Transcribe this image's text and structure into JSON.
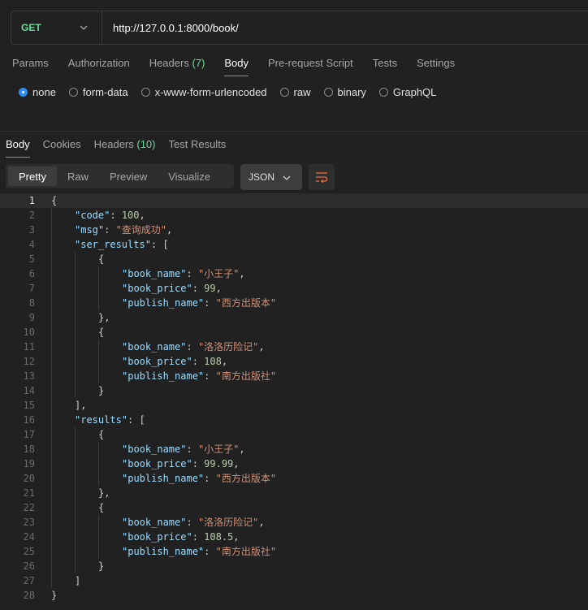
{
  "request": {
    "method": "GET",
    "url": "http://127.0.0.1:8000/book/"
  },
  "request_tabs": [
    {
      "label": "Params",
      "count": ""
    },
    {
      "label": "Authorization",
      "count": ""
    },
    {
      "label": "Headers",
      "count": "(7)"
    },
    {
      "label": "Body",
      "count": "",
      "active": true
    },
    {
      "label": "Pre-request Script",
      "count": ""
    },
    {
      "label": "Tests",
      "count": ""
    },
    {
      "label": "Settings",
      "count": ""
    }
  ],
  "body_types": [
    {
      "label": "none",
      "selected": true
    },
    {
      "label": "form-data",
      "selected": false
    },
    {
      "label": "x-www-form-urlencoded",
      "selected": false
    },
    {
      "label": "raw",
      "selected": false
    },
    {
      "label": "binary",
      "selected": false
    },
    {
      "label": "GraphQL",
      "selected": false
    }
  ],
  "response_tabs": [
    {
      "label": "Body",
      "count": "",
      "active": true
    },
    {
      "label": "Cookies",
      "count": ""
    },
    {
      "label": "Headers",
      "count": "(10)"
    },
    {
      "label": "Test Results",
      "count": ""
    }
  ],
  "view_modes": [
    {
      "label": "Pretty",
      "active": true
    },
    {
      "label": "Raw",
      "active": false
    },
    {
      "label": "Preview",
      "active": false
    },
    {
      "label": "Visualize",
      "active": false
    }
  ],
  "format": "JSON",
  "colors": {
    "key": "#9cdcfe",
    "string": "#ce9178",
    "number": "#b5cea8",
    "punct": "#cfcfcf",
    "method": "#6bdd9a",
    "accent": "#f26b3a",
    "radio": "#2f8df2"
  },
  "icons": {
    "method_dropdown": "chevron-down-icon",
    "format_dropdown": "chevron-down-icon",
    "wrap": "wrap-lines-icon"
  },
  "current_line": 1,
  "response_lines": [
    {
      "n": "1",
      "indent": 0,
      "tokens": [
        [
          "p",
          "{"
        ]
      ]
    },
    {
      "n": "2",
      "indent": 1,
      "tokens": [
        [
          "k",
          "\"code\""
        ],
        [
          "p",
          ": "
        ],
        [
          "n",
          "100"
        ],
        [
          "p",
          ","
        ]
      ]
    },
    {
      "n": "3",
      "indent": 1,
      "tokens": [
        [
          "k",
          "\"msg\""
        ],
        [
          "p",
          ": "
        ],
        [
          "s",
          "\"查询成功\""
        ],
        [
          "p",
          ","
        ]
      ]
    },
    {
      "n": "4",
      "indent": 1,
      "tokens": [
        [
          "k",
          "\"ser_results\""
        ],
        [
          "p",
          ": ["
        ]
      ]
    },
    {
      "n": "5",
      "indent": 2,
      "tokens": [
        [
          "p",
          "{"
        ]
      ]
    },
    {
      "n": "6",
      "indent": 3,
      "tokens": [
        [
          "k",
          "\"book_name\""
        ],
        [
          "p",
          ": "
        ],
        [
          "s",
          "\"小王子\""
        ],
        [
          "p",
          ","
        ]
      ]
    },
    {
      "n": "7",
      "indent": 3,
      "tokens": [
        [
          "k",
          "\"book_price\""
        ],
        [
          "p",
          ": "
        ],
        [
          "n",
          "99"
        ],
        [
          "p",
          ","
        ]
      ]
    },
    {
      "n": "8",
      "indent": 3,
      "tokens": [
        [
          "k",
          "\"publish_name\""
        ],
        [
          "p",
          ": "
        ],
        [
          "s",
          "\"西方出版本\""
        ]
      ]
    },
    {
      "n": "9",
      "indent": 2,
      "tokens": [
        [
          "p",
          "},"
        ]
      ]
    },
    {
      "n": "10",
      "indent": 2,
      "tokens": [
        [
          "p",
          "{"
        ]
      ]
    },
    {
      "n": "11",
      "indent": 3,
      "tokens": [
        [
          "k",
          "\"book_name\""
        ],
        [
          "p",
          ": "
        ],
        [
          "s",
          "\"洛洛历险记\""
        ],
        [
          "p",
          ","
        ]
      ]
    },
    {
      "n": "12",
      "indent": 3,
      "tokens": [
        [
          "k",
          "\"book_price\""
        ],
        [
          "p",
          ": "
        ],
        [
          "n",
          "108"
        ],
        [
          "p",
          ","
        ]
      ]
    },
    {
      "n": "13",
      "indent": 3,
      "tokens": [
        [
          "k",
          "\"publish_name\""
        ],
        [
          "p",
          ": "
        ],
        [
          "s",
          "\"南方出版社\""
        ]
      ]
    },
    {
      "n": "14",
      "indent": 2,
      "tokens": [
        [
          "p",
          "}"
        ]
      ]
    },
    {
      "n": "15",
      "indent": 1,
      "tokens": [
        [
          "p",
          "],"
        ]
      ]
    },
    {
      "n": "16",
      "indent": 1,
      "tokens": [
        [
          "k",
          "\"results\""
        ],
        [
          "p",
          ": ["
        ]
      ]
    },
    {
      "n": "17",
      "indent": 2,
      "tokens": [
        [
          "p",
          "{"
        ]
      ]
    },
    {
      "n": "18",
      "indent": 3,
      "tokens": [
        [
          "k",
          "\"book_name\""
        ],
        [
          "p",
          ": "
        ],
        [
          "s",
          "\"小王子\""
        ],
        [
          "p",
          ","
        ]
      ]
    },
    {
      "n": "19",
      "indent": 3,
      "tokens": [
        [
          "k",
          "\"book_price\""
        ],
        [
          "p",
          ": "
        ],
        [
          "n",
          "99.99"
        ],
        [
          "p",
          ","
        ]
      ]
    },
    {
      "n": "20",
      "indent": 3,
      "tokens": [
        [
          "k",
          "\"publish_name\""
        ],
        [
          "p",
          ": "
        ],
        [
          "s",
          "\"西方出版本\""
        ]
      ]
    },
    {
      "n": "21",
      "indent": 2,
      "tokens": [
        [
          "p",
          "},"
        ]
      ]
    },
    {
      "n": "22",
      "indent": 2,
      "tokens": [
        [
          "p",
          "{"
        ]
      ]
    },
    {
      "n": "23",
      "indent": 3,
      "tokens": [
        [
          "k",
          "\"book_name\""
        ],
        [
          "p",
          ": "
        ],
        [
          "s",
          "\"洛洛历险记\""
        ],
        [
          "p",
          ","
        ]
      ]
    },
    {
      "n": "24",
      "indent": 3,
      "tokens": [
        [
          "k",
          "\"book_price\""
        ],
        [
          "p",
          ": "
        ],
        [
          "n",
          "108.5"
        ],
        [
          "p",
          ","
        ]
      ]
    },
    {
      "n": "25",
      "indent": 3,
      "tokens": [
        [
          "k",
          "\"publish_name\""
        ],
        [
          "p",
          ": "
        ],
        [
          "s",
          "\"南方出版社\""
        ]
      ]
    },
    {
      "n": "26",
      "indent": 2,
      "tokens": [
        [
          "p",
          "}"
        ]
      ]
    },
    {
      "n": "27",
      "indent": 1,
      "tokens": [
        [
          "p",
          "]"
        ]
      ]
    },
    {
      "n": "28",
      "indent": 0,
      "tokens": [
        [
          "p",
          "}"
        ]
      ]
    }
  ]
}
